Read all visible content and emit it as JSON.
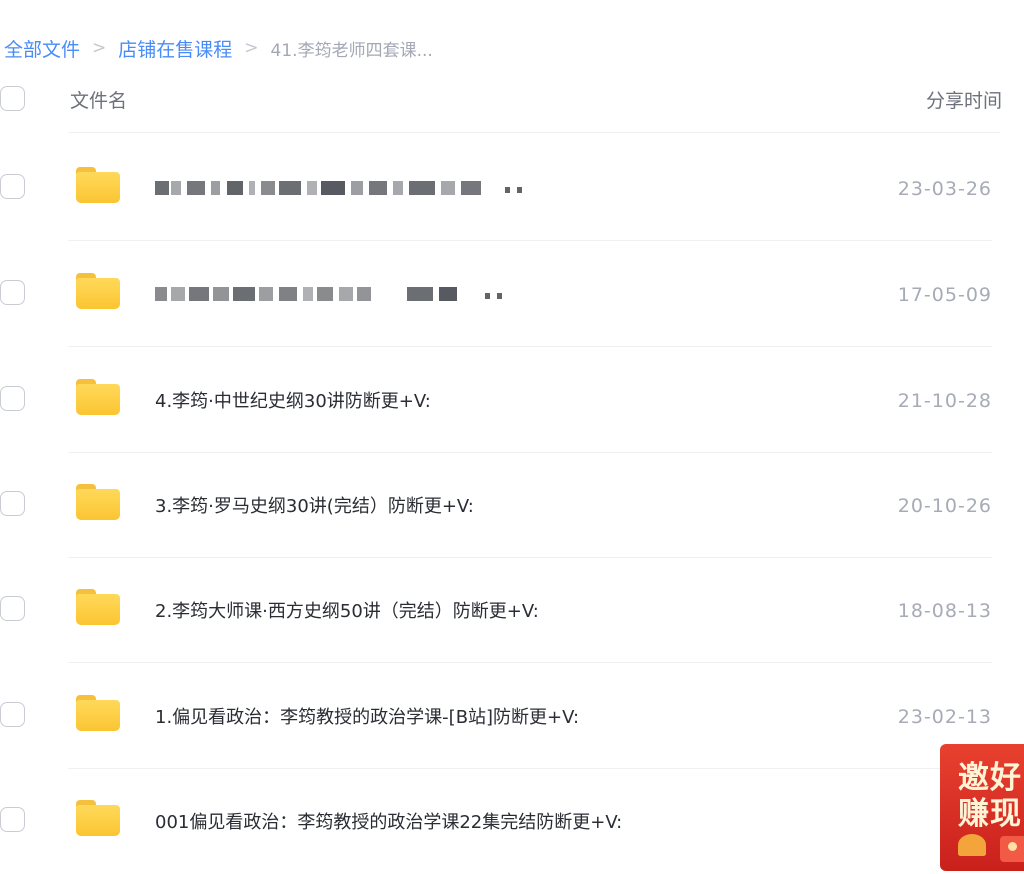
{
  "breadcrumb": {
    "items": [
      "全部文件",
      "店铺在售课程"
    ],
    "current": "41.李筠老师四套课...",
    "separator": ">"
  },
  "table": {
    "header": {
      "name": "文件名",
      "time": "分享时间"
    },
    "rows": [
      {
        "name": "",
        "time": "23-03-26",
        "redacted": true
      },
      {
        "name": "",
        "time": "17-05-09",
        "redacted": true
      },
      {
        "name": "4.李筠·中世纪史纲30讲防断更+V:",
        "time": "21-10-28"
      },
      {
        "name": "3.李筠·罗马史纲30讲(完结）防断更+V:",
        "time": "20-10-26"
      },
      {
        "name": "2.李筠大师课·西方史纲50讲（完结）防断更+V:",
        "time": "18-08-13"
      },
      {
        "name": "1.偏见看政治：李筠教授的政治学课-[B站]防断更+V:",
        "time": "23-02-13"
      },
      {
        "name": "001偏见看政治：李筠教授的政治学课22集完结防断更+V:",
        "time": "23-0"
      }
    ]
  },
  "promo": {
    "line1": "邀好",
    "line2": "赚现"
  },
  "colors": {
    "link": "#4a8cf7",
    "folder": "#fbc532",
    "promo": "#d62b20"
  }
}
